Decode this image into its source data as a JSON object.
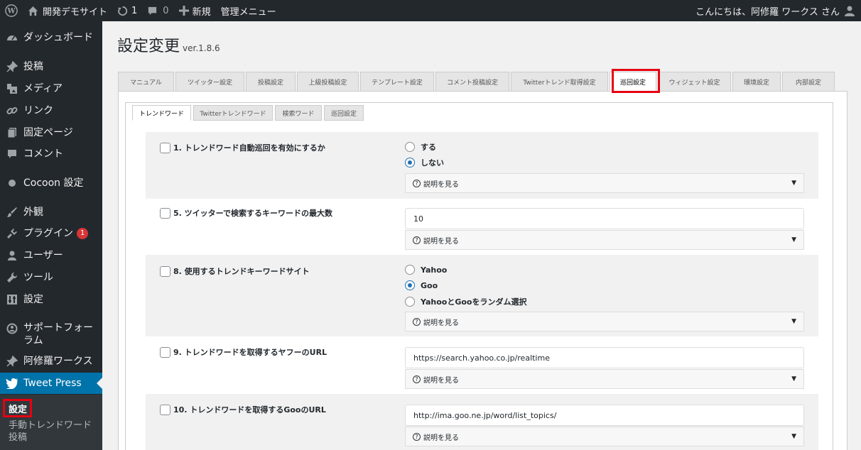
{
  "adminbar": {
    "wp_logo_icon": "wordpress-logo-icon",
    "site_name": "開発デモサイト",
    "updates_count": "1",
    "comments_count": "0",
    "new_label": "新規",
    "admin_menu_label": "管理メニュー",
    "greeting": "こんにちは、阿修羅 ワークス さん"
  },
  "sidebar": {
    "items": [
      {
        "label": "ダッシュボード",
        "icon": "dashboard-icon"
      },
      {
        "label": "投稿",
        "icon": "pin-icon"
      },
      {
        "label": "メディア",
        "icon": "media-icon"
      },
      {
        "label": "リンク",
        "icon": "link-icon"
      },
      {
        "label": "固定ページ",
        "icon": "page-icon"
      },
      {
        "label": "コメント",
        "icon": "comment-icon"
      },
      {
        "label": "Cocoon 設定",
        "icon": "circle-icon"
      },
      {
        "label": "外観",
        "icon": "brush-icon"
      },
      {
        "label": "プラグイン",
        "icon": "plugin-icon",
        "badge": "1"
      },
      {
        "label": "ユーザー",
        "icon": "user-icon"
      },
      {
        "label": "ツール",
        "icon": "wrench-icon"
      },
      {
        "label": "設定",
        "icon": "settings-icon"
      },
      {
        "label": "サポートフォーラム",
        "icon": "support-icon"
      },
      {
        "label": "阿修羅ワークス",
        "icon": "pin-icon"
      },
      {
        "label": "Tweet Press",
        "icon": "twitter-icon"
      }
    ],
    "submenu": {
      "current": "設定",
      "other": "手動トレンドワード投稿"
    }
  },
  "page": {
    "title": "設定変更",
    "version": "ver.1.8.6"
  },
  "tabs": [
    "マニュアル",
    "ツイッター設定",
    "投稿設定",
    "上級投稿設定",
    "テンプレート設定",
    "コメント投稿設定",
    "Twitterトレンド取得設定",
    "巡回設定",
    "ウィジェット設定",
    "環境設定",
    "内部設定"
  ],
  "subtabs": [
    "トレンドワード",
    "Twitterトレンドワード",
    "検索ワード",
    "巡回設定"
  ],
  "details_label": "説明を見る",
  "details_icon": "question-circle-icon",
  "settings": {
    "s1": {
      "label": "1. トレンドワード自動巡回を有効にするか",
      "opt1": "する",
      "opt2": "しない",
      "selected": "しない"
    },
    "s5": {
      "label": "5. ツイッターで検索するキーワードの最大数",
      "value": "10"
    },
    "s8": {
      "label": "8. 使用するトレンドキーワードサイト",
      "opt1": "Yahoo",
      "opt2": "Goo",
      "opt3": "YahooとGooをランダム選択",
      "selected": "Goo"
    },
    "s9": {
      "label": "9. トレンドワードを取得するヤフーのURL",
      "value": "https://search.yahoo.co.jp/realtime"
    },
    "s10": {
      "label": "10. トレンドワードを取得するGooのURL",
      "value": "http://ima.goo.ne.jp/word/list_topics/"
    }
  },
  "colors": {
    "accent": "#0073aa",
    "highlight": "#e60012",
    "adminbar": "#23282d"
  }
}
